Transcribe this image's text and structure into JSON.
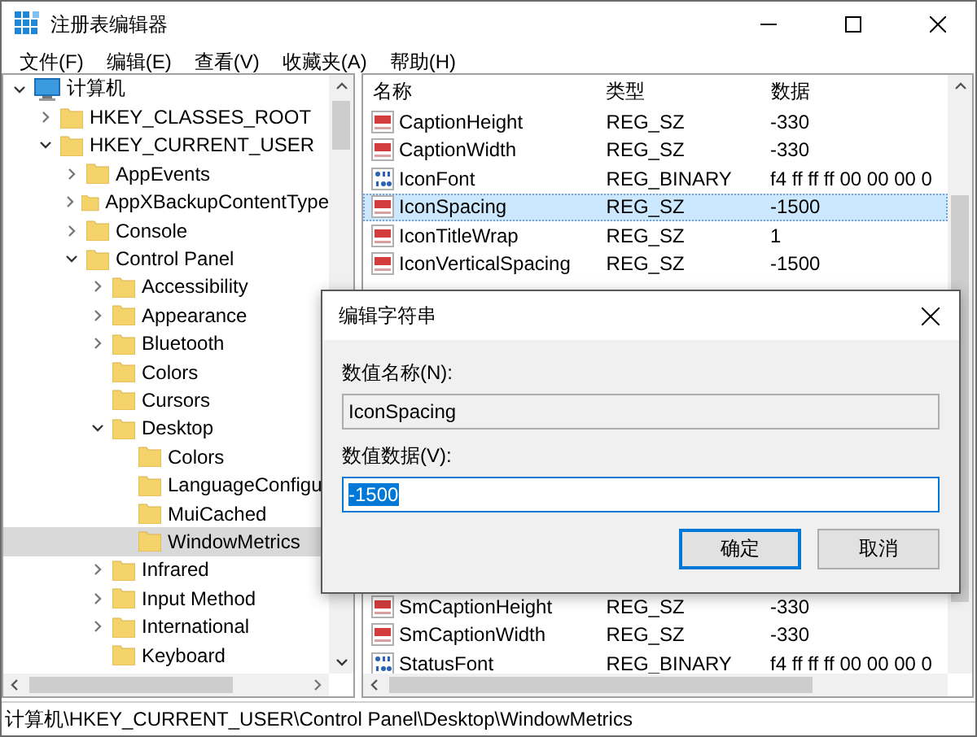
{
  "window": {
    "title": "注册表编辑器"
  },
  "menu": [
    "文件(F)",
    "编辑(E)",
    "查看(V)",
    "收藏夹(A)",
    "帮助(H)"
  ],
  "tree": [
    {
      "label": "计算机",
      "kind": "computer",
      "expanded": true,
      "selected": false,
      "children": [
        {
          "label": "HKEY_CLASSES_ROOT",
          "kind": "branch",
          "expanded": false,
          "selected": false
        },
        {
          "label": "HKEY_CURRENT_USER",
          "kind": "branch",
          "expanded": true,
          "selected": false,
          "children": [
            {
              "label": "AppEvents",
              "kind": "branch",
              "expanded": false,
              "selected": false
            },
            {
              "label": "AppXBackupContentType",
              "kind": "branch",
              "expanded": false,
              "selected": false
            },
            {
              "label": "Console",
              "kind": "branch",
              "expanded": false,
              "selected": false
            },
            {
              "label": "Control Panel",
              "kind": "branch",
              "expanded": true,
              "selected": false,
              "children": [
                {
                  "label": "Accessibility",
                  "kind": "branch",
                  "expanded": false,
                  "selected": false
                },
                {
                  "label": "Appearance",
                  "kind": "branch",
                  "expanded": false,
                  "selected": false
                },
                {
                  "label": "Bluetooth",
                  "kind": "branch",
                  "expanded": false,
                  "selected": false
                },
                {
                  "label": "Colors",
                  "kind": "leaf",
                  "selected": false
                },
                {
                  "label": "Cursors",
                  "kind": "leaf",
                  "selected": false
                },
                {
                  "label": "Desktop",
                  "kind": "branch",
                  "expanded": true,
                  "selected": false,
                  "children": [
                    {
                      "label": "Colors",
                      "kind": "leaf",
                      "selected": false
                    },
                    {
                      "label": "LanguageConfigu",
                      "kind": "leaf",
                      "selected": false
                    },
                    {
                      "label": "MuiCached",
                      "kind": "leaf",
                      "selected": false
                    },
                    {
                      "label": "WindowMetrics",
                      "kind": "leaf",
                      "selected": true
                    }
                  ]
                },
                {
                  "label": "Infrared",
                  "kind": "branch",
                  "expanded": false,
                  "selected": false
                },
                {
                  "label": "Input Method",
                  "kind": "branch",
                  "expanded": false,
                  "selected": false
                },
                {
                  "label": "International",
                  "kind": "branch",
                  "expanded": false,
                  "selected": false
                },
                {
                  "label": "Keyboard",
                  "kind": "leaf",
                  "selected": false
                }
              ]
            }
          ]
        }
      ]
    }
  ],
  "table": {
    "columns": [
      "名称",
      "类型",
      "数据"
    ],
    "rows": [
      {
        "name": "CaptionHeight",
        "kind": "string",
        "type": "REG_SZ",
        "data": "-330",
        "selected": false
      },
      {
        "name": "CaptionWidth",
        "kind": "string",
        "type": "REG_SZ",
        "data": "-330",
        "selected": false
      },
      {
        "name": "IconFont",
        "kind": "binary",
        "type": "REG_BINARY",
        "data": "f4 ff ff ff 00 00 00 0",
        "selected": false
      },
      {
        "name": "IconSpacing",
        "kind": "string",
        "type": "REG_SZ",
        "data": "-1500",
        "selected": true
      },
      {
        "name": "IconTitleWrap",
        "kind": "string",
        "type": "REG_SZ",
        "data": "1",
        "selected": false
      },
      {
        "name": "IconVerticalSpacing",
        "kind": "string",
        "type": "REG_SZ",
        "data": "-1500",
        "selected": false
      },
      {
        "name": "SmCaptionHeight",
        "kind": "string",
        "type": "REG_SZ",
        "data": "-330",
        "selected": false
      },
      {
        "name": "SmCaptionWidth",
        "kind": "string",
        "type": "REG_SZ",
        "data": "-330",
        "selected": false
      },
      {
        "name": "StatusFont",
        "kind": "binary",
        "type": "REG_BINARY",
        "data": "f4 ff ff ff 00 00 00 0",
        "selected": false
      }
    ]
  },
  "dialog": {
    "title": "编辑字符串",
    "name_label": "数值名称(N):",
    "name_value": "IconSpacing",
    "data_label": "数值数据(V):",
    "data_value": "-1500",
    "buttons": [
      {
        "label": "确定",
        "default": true
      },
      {
        "label": "取消",
        "default": false
      }
    ]
  },
  "status_bar": "计算机\\HKEY_CURRENT_USER\\Control Panel\\Desktop\\WindowMetrics"
}
